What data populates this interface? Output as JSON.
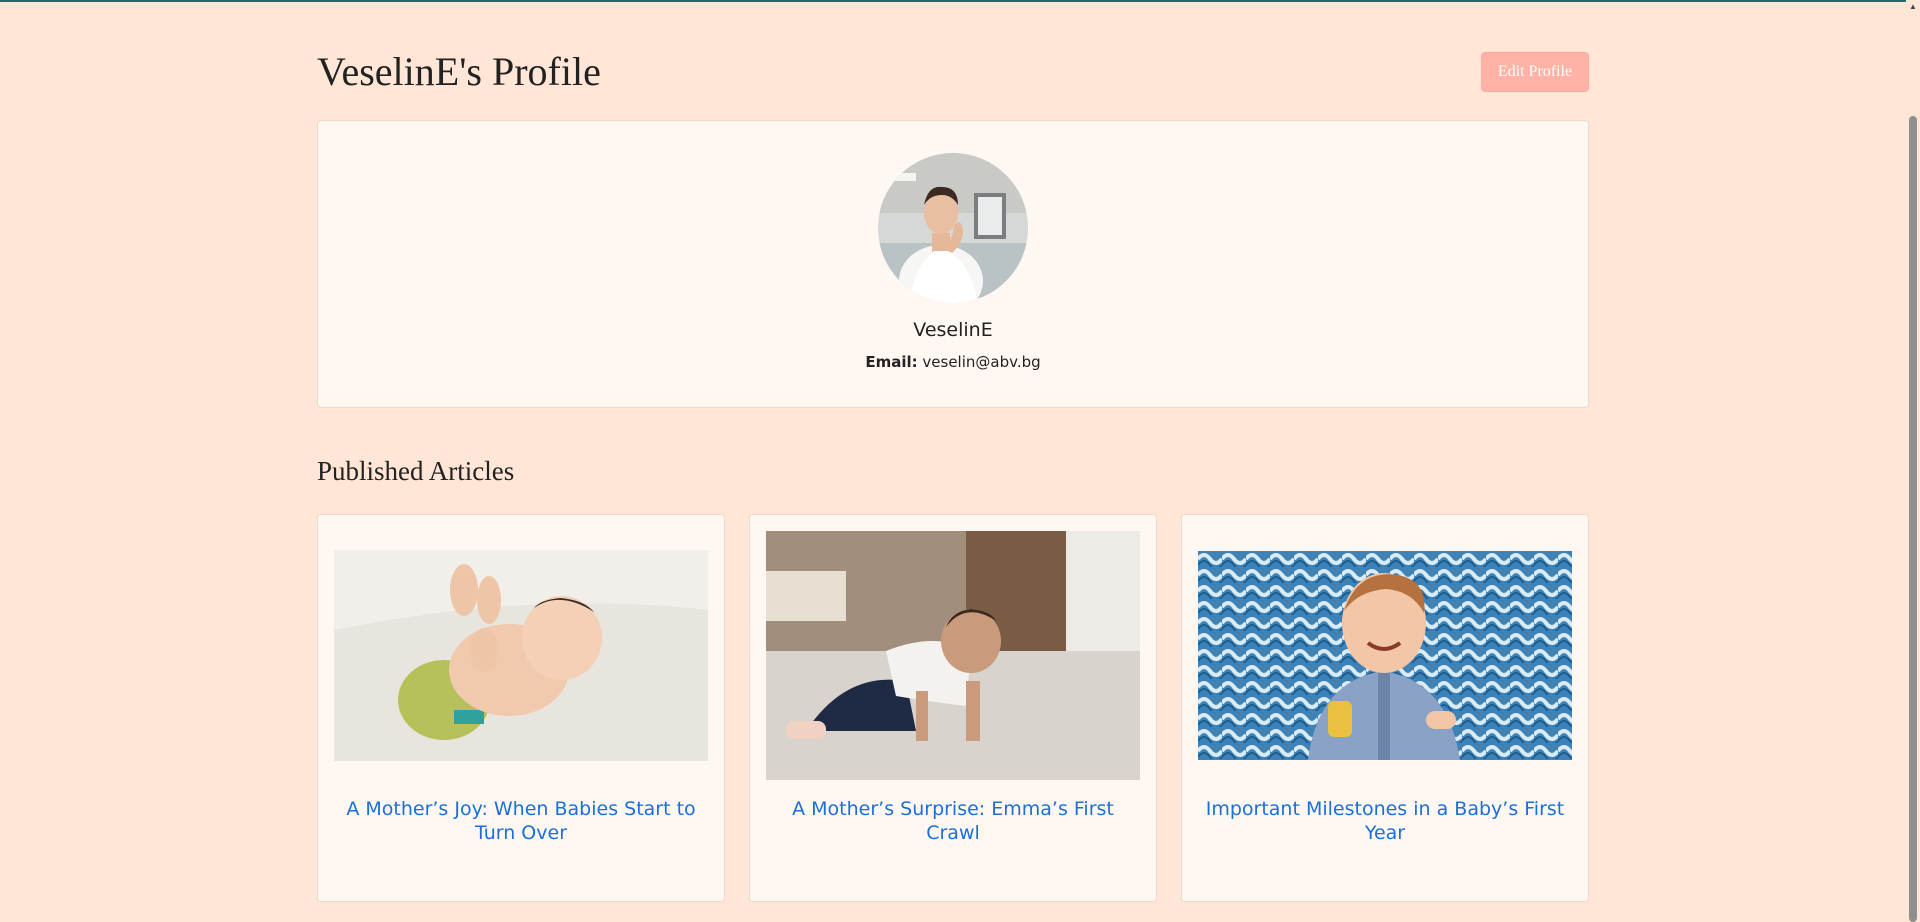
{
  "profile": {
    "page_title": "VeselinE's Profile",
    "edit_button": "Edit Profile",
    "username": "VeselinE",
    "email_label": "Email:",
    "email_value": "veselin@abv.bg"
  },
  "articles_section": {
    "title": "Published Articles",
    "articles": [
      {
        "title": "A Mother’s Joy: When Babies Start to Turn Over"
      },
      {
        "title": "A Mother’s Surprise: Emma’s First Crawl"
      },
      {
        "title": "Important Milestones in a Baby’s First Year"
      }
    ]
  },
  "colors": {
    "page_background": "#ffe6d7",
    "card_background": "#fff7f1",
    "accent_button": "#ffb2a5",
    "link": "#1a6fd9"
  }
}
